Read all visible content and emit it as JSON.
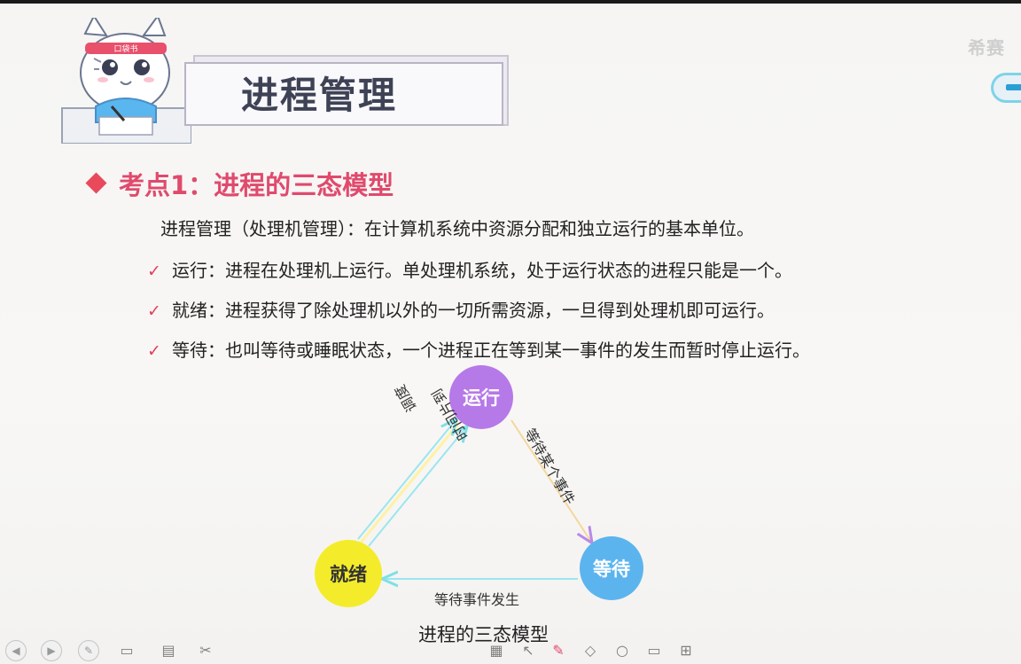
{
  "slide": {
    "title": "进程管理",
    "section_heading": "考点1：进程的三态模型",
    "definition": "进程管理（处理机管理）：在计算机系统中资源分配和独立运行的基本单位。",
    "bullets": [
      "运行：进程在处理机上运行。单处理机系统，处于运行状态的进程只能是一个。",
      "就绪：进程获得了除处理机以外的一切所需资源，一旦得到处理机即可运行。",
      "等待：也叫等待或睡眠状态，一个进程正在等到某一事件的发生而暂时停止运行。"
    ],
    "check_symbol": "✓"
  },
  "diagram": {
    "states": {
      "running": "运行",
      "ready": "就绪",
      "waiting": "等待"
    },
    "transitions": {
      "schedule": "调度",
      "time_slice": "时间片到",
      "wait_event": "等待某个事件",
      "event_occurs": "等待事件发生"
    },
    "caption": "进程的三态模型",
    "colors": {
      "running": "#b679e8",
      "waiting": "#5cb4ee",
      "ready": "#f4ec2a"
    }
  },
  "mascot": {
    "headband_text": "口袋书"
  },
  "watermark": "希赛"
}
